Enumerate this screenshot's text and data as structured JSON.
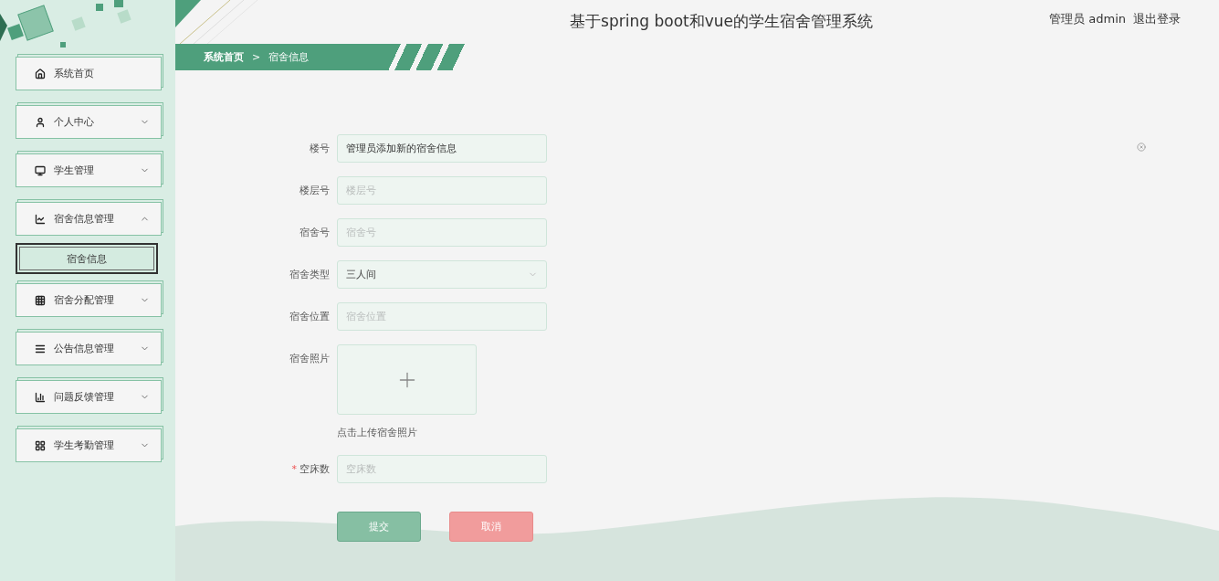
{
  "header": {
    "title": "基于spring boot和vue的学生宿舍管理系统",
    "user": "管理员 admin",
    "logout": "退出登录"
  },
  "breadcrumb": {
    "items": [
      "系统首页",
      "宿舍信息"
    ],
    "separator": ">"
  },
  "menu": [
    {
      "label": "系统首页",
      "kind": "link"
    },
    {
      "label": "个人中心",
      "kind": "group",
      "expanded": false
    },
    {
      "label": "学生管理",
      "kind": "group",
      "expanded": false
    },
    {
      "label": "宿舍信息管理",
      "kind": "group",
      "expanded": true,
      "children": [
        {
          "label": "宿舍信息",
          "selected": true
        }
      ]
    },
    {
      "label": "宿舍分配管理",
      "kind": "group",
      "expanded": false
    },
    {
      "label": "公告信息管理",
      "kind": "group",
      "expanded": false
    },
    {
      "label": "问题反馈管理",
      "kind": "group",
      "expanded": false
    },
    {
      "label": "学生考勤管理",
      "kind": "group",
      "expanded": false
    }
  ],
  "form": {
    "required_mark": "*",
    "fields": [
      {
        "kind": "input",
        "label": "楼号",
        "value": "管理员添加新的宿舍信息",
        "required": false
      },
      {
        "kind": "input",
        "label": "楼层号",
        "placeholder": "楼层号",
        "required": false
      },
      {
        "kind": "input",
        "label": "宿舍号",
        "placeholder": "宿舍号",
        "required": false
      },
      {
        "kind": "select",
        "label": "宿舍类型",
        "value": "三人间",
        "required": false
      },
      {
        "kind": "input",
        "label": "宿舍位置",
        "placeholder": "宿舍位置",
        "required": false
      },
      {
        "kind": "upload",
        "label": "宿舍照片",
        "hint": "点击上传宿舍照片",
        "required": false
      },
      {
        "kind": "input",
        "label": "空床数",
        "placeholder": "空床数",
        "required": true
      }
    ],
    "buttons": [
      {
        "label": "提交",
        "kind": "primary"
      },
      {
        "label": "取消",
        "kind": "danger"
      }
    ]
  }
}
